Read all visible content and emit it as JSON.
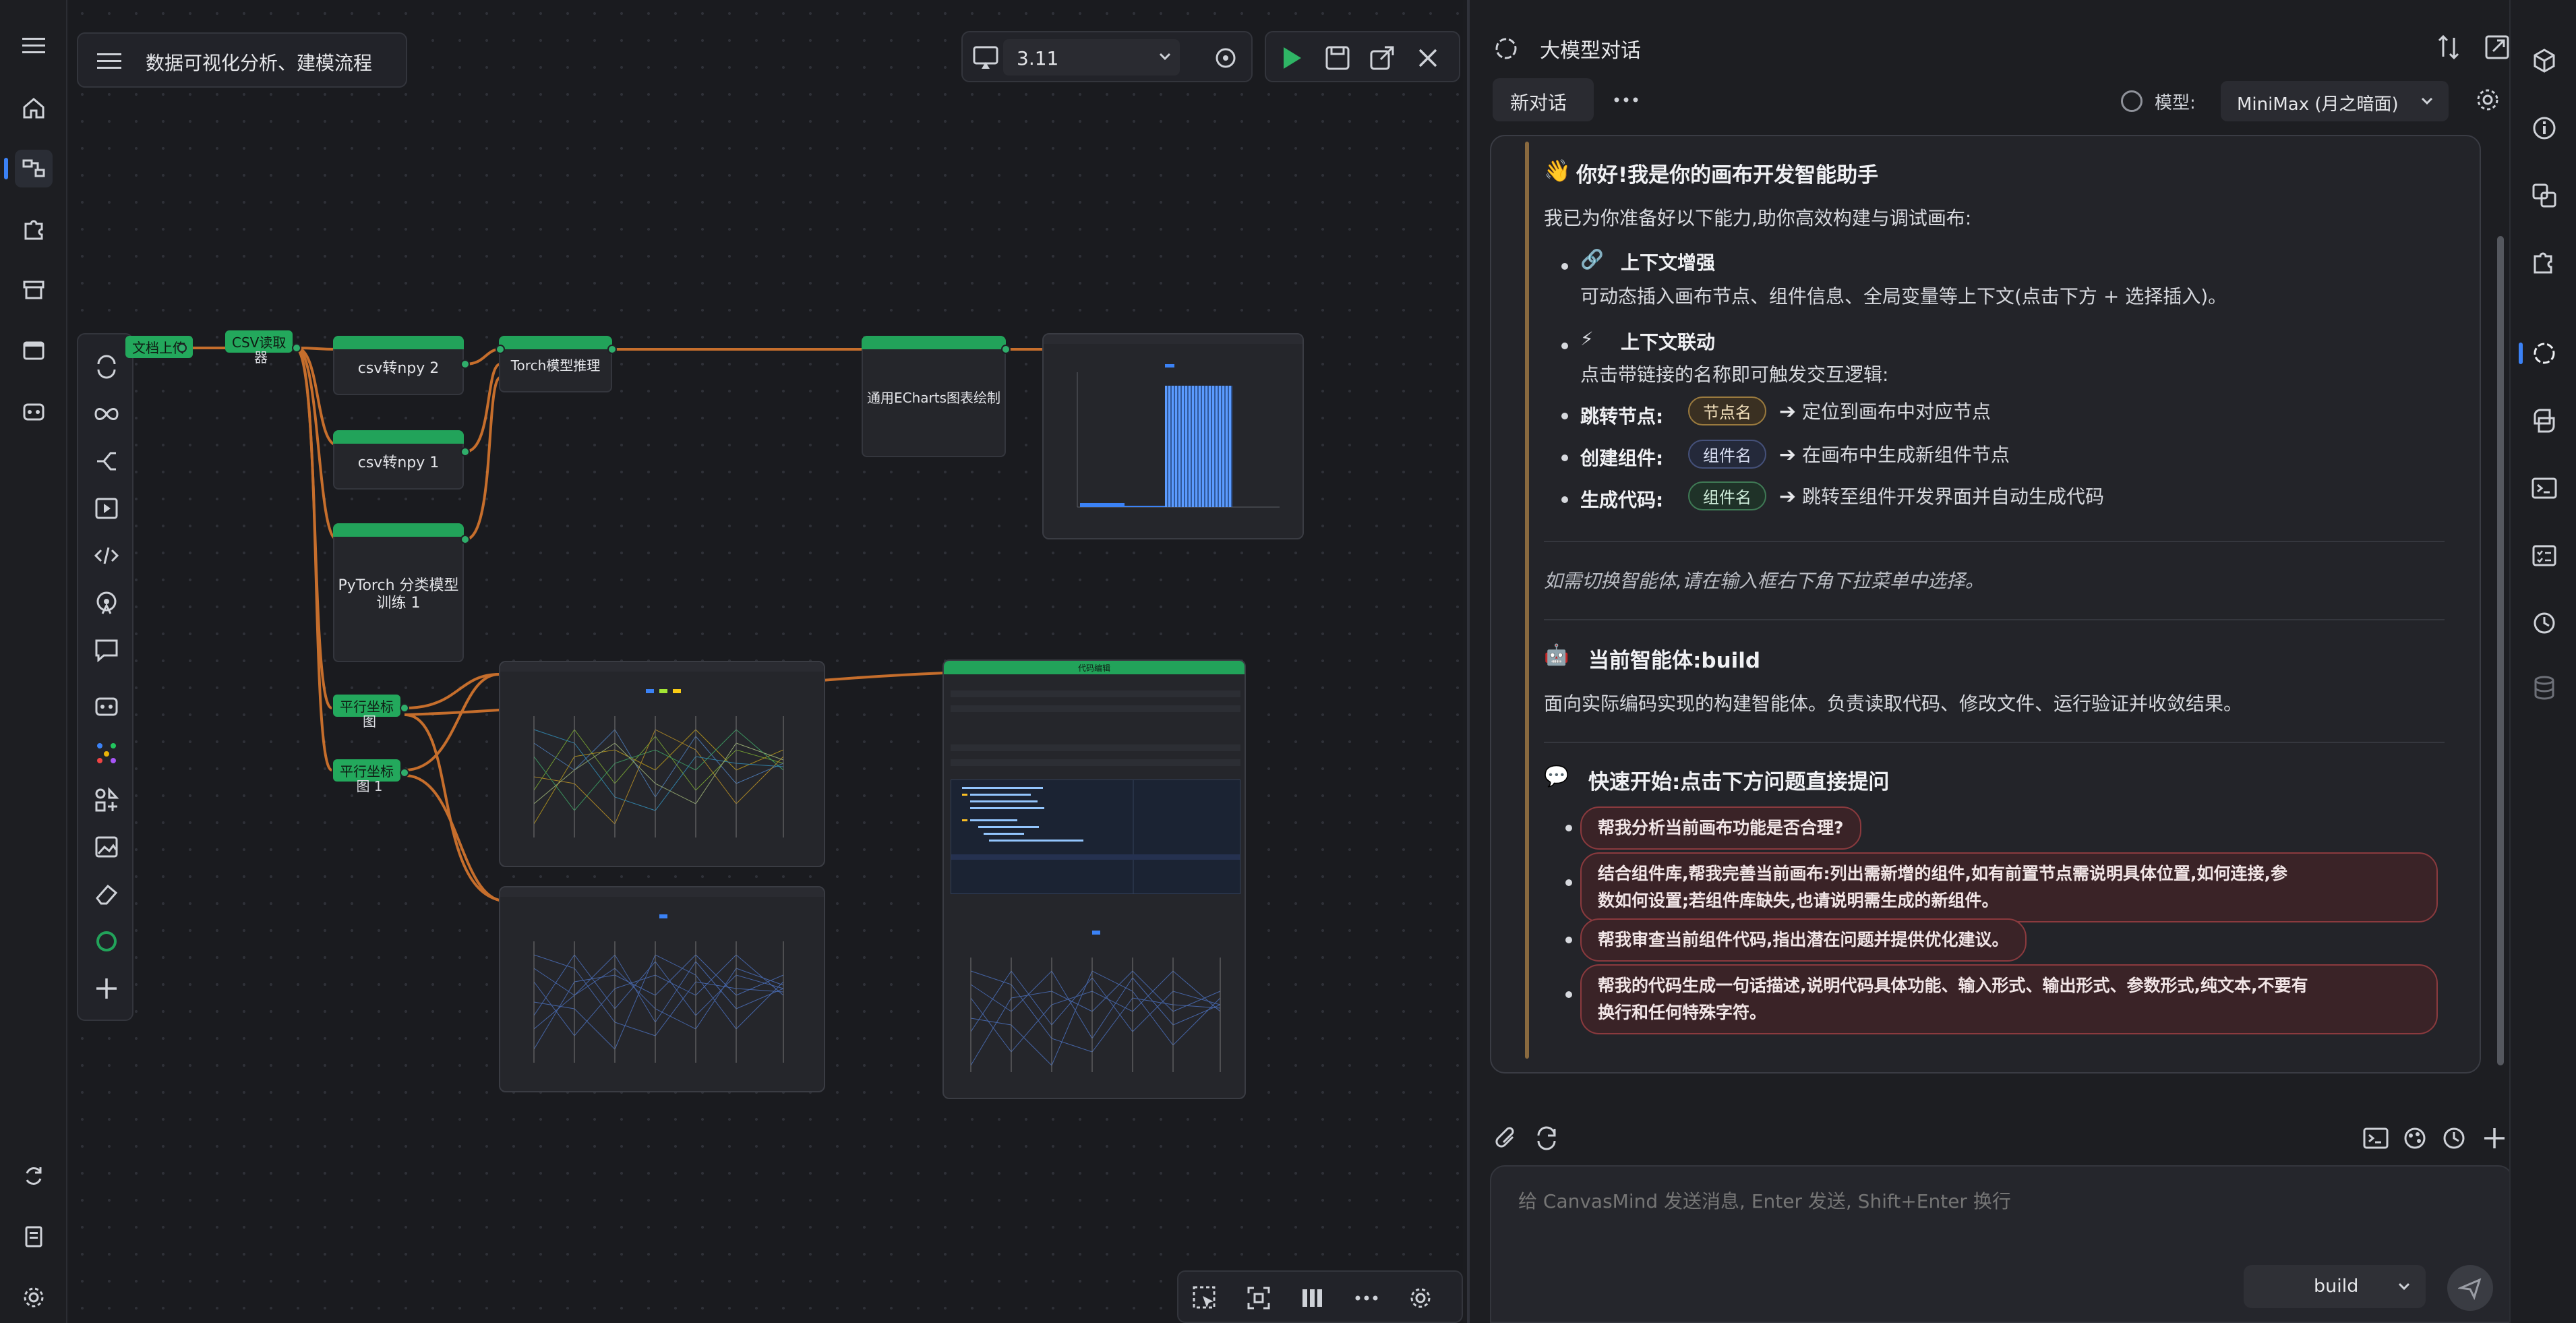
{
  "flow_title": "数据可视化分析、建模流程",
  "python_version": "3.11",
  "nodes": {
    "upload": "文档上传",
    "csv_read_1": "CSV读取",
    "csv_read_2": "器",
    "csv_npy_2": "csv转npy 2",
    "csv_npy_1": "csv转npy 1",
    "pytorch_1": "PyTorch 分类模型",
    "pytorch_2": "训练 1",
    "torch_infer": "Torch模型推理",
    "echarts": "通用ECharts图表绘制",
    "parallel_a_1": "平行坐标",
    "parallel_a_2": "图",
    "parallel_b_1": "平行坐标",
    "parallel_b_2": "图 1",
    "code_edit": "代码编辑"
  },
  "chat": {
    "title": "大模型对话",
    "new_chat": "新对话",
    "model_label": "模型:",
    "model_value": "MiniMax (月之暗面)",
    "greeting": "你好!我是你的画布开发智能助手",
    "intro": "我已为你准备好以下能力,助你高效构建与调试画布:",
    "ctx_title": "上下文增强",
    "ctx_desc": "可动态插入画布节点、组件信息、全局变量等上下文(点击下方 + 选择插入)。",
    "link_title": "上下文联动",
    "link_desc": "点击带链接的名称即可触发交互逻辑:",
    "jump_label": "跳转节点:",
    "jump_pill": "节点名",
    "jump_desc": "定位到画布中对应节点",
    "create_label": "创建组件:",
    "create_pill": "组件名",
    "create_desc": "在画布中生成新组件节点",
    "gen_label": "生成代码:",
    "gen_pill": "组件名",
    "gen_desc": "跳转至组件开发界面并自动生成代码",
    "switch_hint": "如需切换智能体,请在输入框右下角下拉菜单中选择。",
    "agent_title": "当前智能体:build",
    "agent_desc": "面向实际编码实现的构建智能体。负责读取代码、修改文件、运行验证并收敛结果。",
    "quick_title": "快速开始:点击下方问题直接提问",
    "q1": "帮我分析当前画布功能是否合理?",
    "q2a": "结合组件库,帮我完善当前画布:列出需新增的组件,如有前置节点需说明具体位置,如何连接,参",
    "q2b": "数如何设置;若组件库缺失,也请说明需生成的新组件。",
    "q3": "帮我审查当前组件代码,指出潜在问题并提供优化建议。",
    "q4a": "帮我的代码生成一句话描述,说明代码具体功能、输入形式、输出形式、参数形式,纯文本,不要有",
    "q4b": "换行和任何特殊字符。",
    "input_placeholder": "给 CanvasMind 发送消息, Enter 发送, Shift+Enter 换行",
    "agent_select": "build"
  },
  "colors": {
    "accent": "#22a35a",
    "edge": "#d9782e",
    "highlight": "#3b82f6"
  }
}
